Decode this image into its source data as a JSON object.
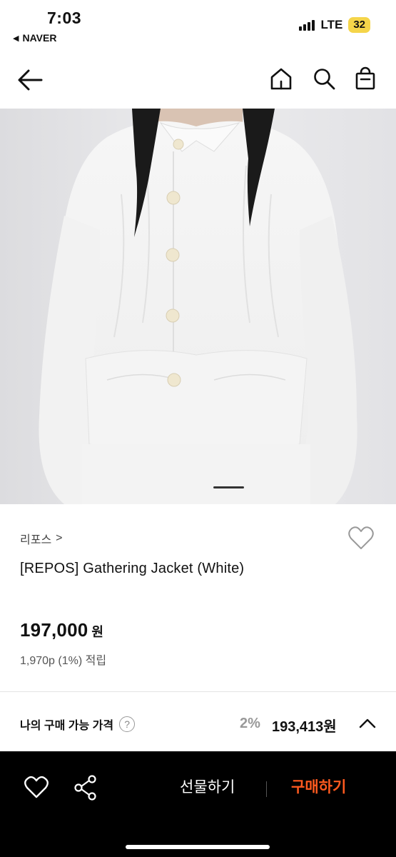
{
  "status": {
    "time": "7:03",
    "back_app": "NAVER",
    "network": "LTE",
    "battery": "32"
  },
  "nav": {
    "icons": [
      "back-arrow-icon",
      "home-icon",
      "search-icon",
      "shopping-bag-icon"
    ]
  },
  "gallery": {
    "image_alt": "model wearing white gathered jacket",
    "slide_count": 3,
    "active_slide": 3
  },
  "product": {
    "brand": "리포스",
    "brand_chevron": ">",
    "title": "[REPOS] Gathering Jacket (White)",
    "price": "197,000",
    "price_unit": "원",
    "points": "1,970p (1%) 적립"
  },
  "my_price": {
    "label": "나의 구매 가능 가격",
    "help": "?",
    "discount": "2%",
    "price": "193,413원"
  },
  "bottom_bar": {
    "gift": "선물하기",
    "buy": "구매하기"
  },
  "colors": {
    "accent": "#ff5a1f",
    "bar_bg": "#000000",
    "battery": "#f5d54a"
  }
}
